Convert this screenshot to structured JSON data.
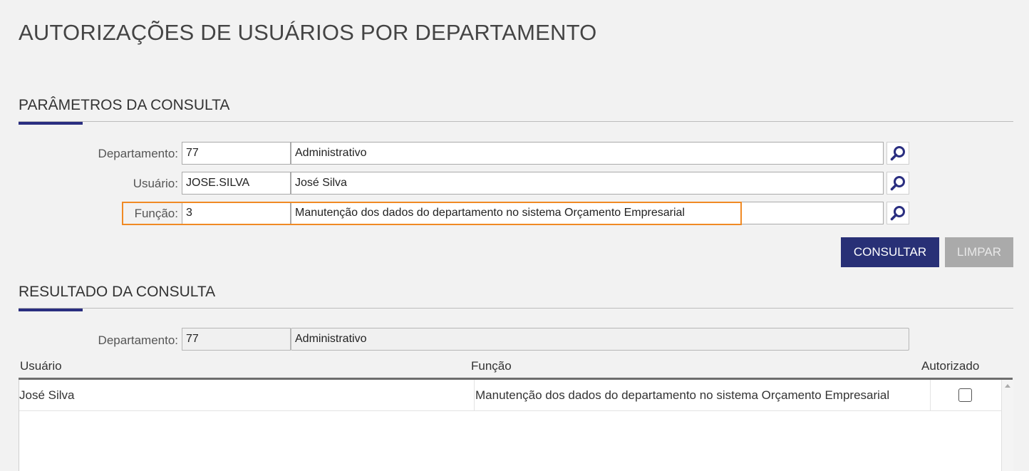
{
  "page": {
    "title": "AUTORIZAÇÕES DE USUÁRIOS POR DEPARTAMENTO"
  },
  "params": {
    "section_title": "PARÂMETROS DA CONSULTA",
    "departamento": {
      "label": "Departamento:",
      "code": "77",
      "name": "Administrativo"
    },
    "usuario": {
      "label": "Usuário:",
      "code": "JOSE.SILVA",
      "name": "José Silva"
    },
    "funcao": {
      "label": "Função:",
      "code": "3",
      "name": "Manutenção dos dados do departamento no sistema Orçamento Empresarial"
    },
    "consultar_label": "CONSULTAR",
    "limpar_label": "LIMPAR"
  },
  "result": {
    "section_title": "RESULTADO DA CONSULTA",
    "departamento": {
      "label": "Departamento:",
      "code": "77",
      "name": "Administrativo"
    },
    "columns": [
      "Usuário",
      "Função",
      "Autorizado"
    ],
    "rows": [
      {
        "usuario": "José Silva",
        "funcao": "Manutenção dos dados do departamento no sistema Orçamento Empresarial",
        "autorizado": false
      }
    ]
  },
  "colors": {
    "primary": "#283076",
    "highlight": "#f08a24",
    "disabled": "#aaaaaa"
  },
  "icons": {
    "lookup": "magnifier-icon"
  }
}
